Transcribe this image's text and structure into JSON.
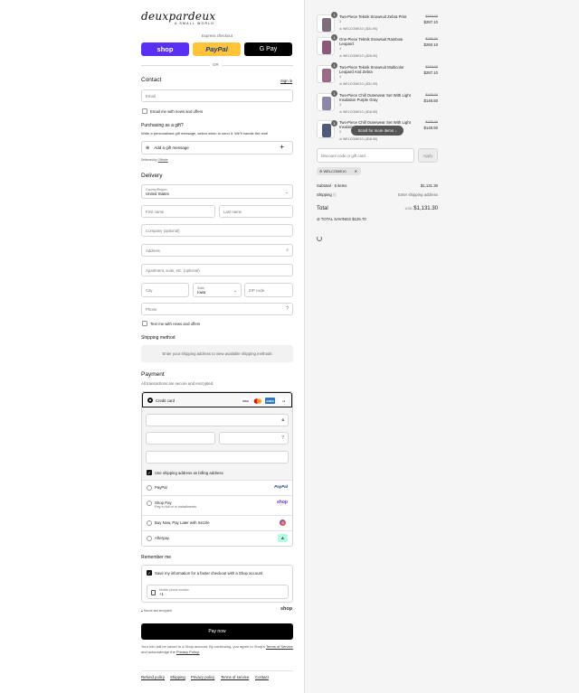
{
  "brand": {
    "logo": "deuxpardeux",
    "tagline": "A SMALL WORLD"
  },
  "express": {
    "label": "Express checkout",
    "shop": "shop",
    "paypal": "PayPal",
    "gpay": "G Pay",
    "or": "OR"
  },
  "contact": {
    "title": "Contact",
    "signin": "Sign in",
    "email_placeholder": "Email",
    "news_label": "Email me with news and offers"
  },
  "gift": {
    "title": "Purchasing as a gift?",
    "desc": "Write a personalised gift message, select when to send it. We'll handle the rest!",
    "add_label": "Add a gift message",
    "plus": "+",
    "delivered_by": "Delivered by",
    "provider": "Giftnote"
  },
  "delivery": {
    "title": "Delivery",
    "country_label": "Country/Region",
    "country_value": "United States",
    "first_name": "First name",
    "last_name": "Last name",
    "company": "Company (optional)",
    "address": "Address",
    "apartment": "Apartment, suite, etc. (optional)",
    "city": "City",
    "state_label": "State",
    "state_value": "Iowa",
    "zip": "ZIP code",
    "phone": "Phone",
    "text_label": "Text me with news and offers"
  },
  "shipping_method": {
    "title": "Shipping method",
    "notice": "Enter your shipping address to view available shipping methods"
  },
  "payment": {
    "title": "Payment",
    "secure_note": "All transactions are secure and encrypted.",
    "credit_card": "Credit card",
    "cards": [
      "VISA",
      "MC",
      "AMEX",
      "+4"
    ],
    "billing_label": "Use shipping address as billing address",
    "options": [
      {
        "label": "PayPal",
        "badge": "PayPal",
        "sub": ""
      },
      {
        "label": "Shop Pay",
        "badge": "shop",
        "sub": "Pay in full or in installments"
      },
      {
        "label": "Buy Now, Pay Later with Sezzle",
        "badge": "S",
        "sub": ""
      },
      {
        "label": "Afterpay",
        "badge": "A",
        "sub": ""
      }
    ]
  },
  "remember": {
    "title": "Remember me",
    "save_label": "Save my information for a faster checkout with a Shop account",
    "mobile_label": "Mobile phone number",
    "mobile_value": "+1",
    "secure": "Secure and encrypted",
    "shop": "shop"
  },
  "paynow": "Pay now",
  "legal": {
    "text1": "Your info will be saved to a Shop account. By continuing, you agree to Shop's",
    "tos": "Terms of Service",
    "and": "and acknowledge the",
    "privacy": "Privacy Policy."
  },
  "footer": [
    "Refund policy",
    "Shipping",
    "Privacy policy",
    "Terms of service",
    "Contact"
  ],
  "cart": {
    "items": [
      {
        "name": "Two-Piece Teknik Snowsuit Zebra Print",
        "variant": "3",
        "discount": "WELCOME10 (-$31.90)",
        "old": "$319.00",
        "new": "$287.10",
        "qty": "1",
        "color": "#7d6e7c"
      },
      {
        "name": "One-Piece Teknik Snowsuit Rainbow Leopard",
        "variant": "4",
        "discount": "WELCOME10 (-$28.90)",
        "old": "$289.00",
        "new": "$260.10",
        "qty": "1",
        "color": "#8b5a78"
      },
      {
        "name": "Two-Piece Teknik Snowsuit Multicolor Leopard And Zebra",
        "variant": "4",
        "discount": "WELCOME10 (-$31.90)",
        "old": "$319.00",
        "new": "$287.10",
        "qty": "1",
        "color": "#9a6a86"
      },
      {
        "name": "Two-Piece Chill Outerwear Set With Light Insulation Purple Gray",
        "variant": "3",
        "discount": "WELCOME10 (-$16.50)",
        "old": "$165.00",
        "new": "$148.50",
        "qty": "1",
        "color": "#8e86a8"
      },
      {
        "name": "Two-Piece Chill Outerwear Set With Light Insulation",
        "variant": "3",
        "discount": "WELCOME10 (-$16.50)",
        "old": "$165.00",
        "new": "$148.50",
        "qty": "1",
        "color": "#4f5a78"
      }
    ],
    "scroll_hint": "Scroll for more items",
    "discount_placeholder": "Discount code or gift card",
    "apply": "Apply",
    "applied_code": "WELCOME10",
    "subtotal_label": "Subtotal · 5 items",
    "subtotal_value": "$1,131.30",
    "shipping_label": "Shipping",
    "shipping_value": "Enter shipping address",
    "total_label": "Total",
    "currency": "USD",
    "total_value": "$1,131.30",
    "savings_label": "TOTAL SAVINGS",
    "savings_value": "$125.70"
  }
}
